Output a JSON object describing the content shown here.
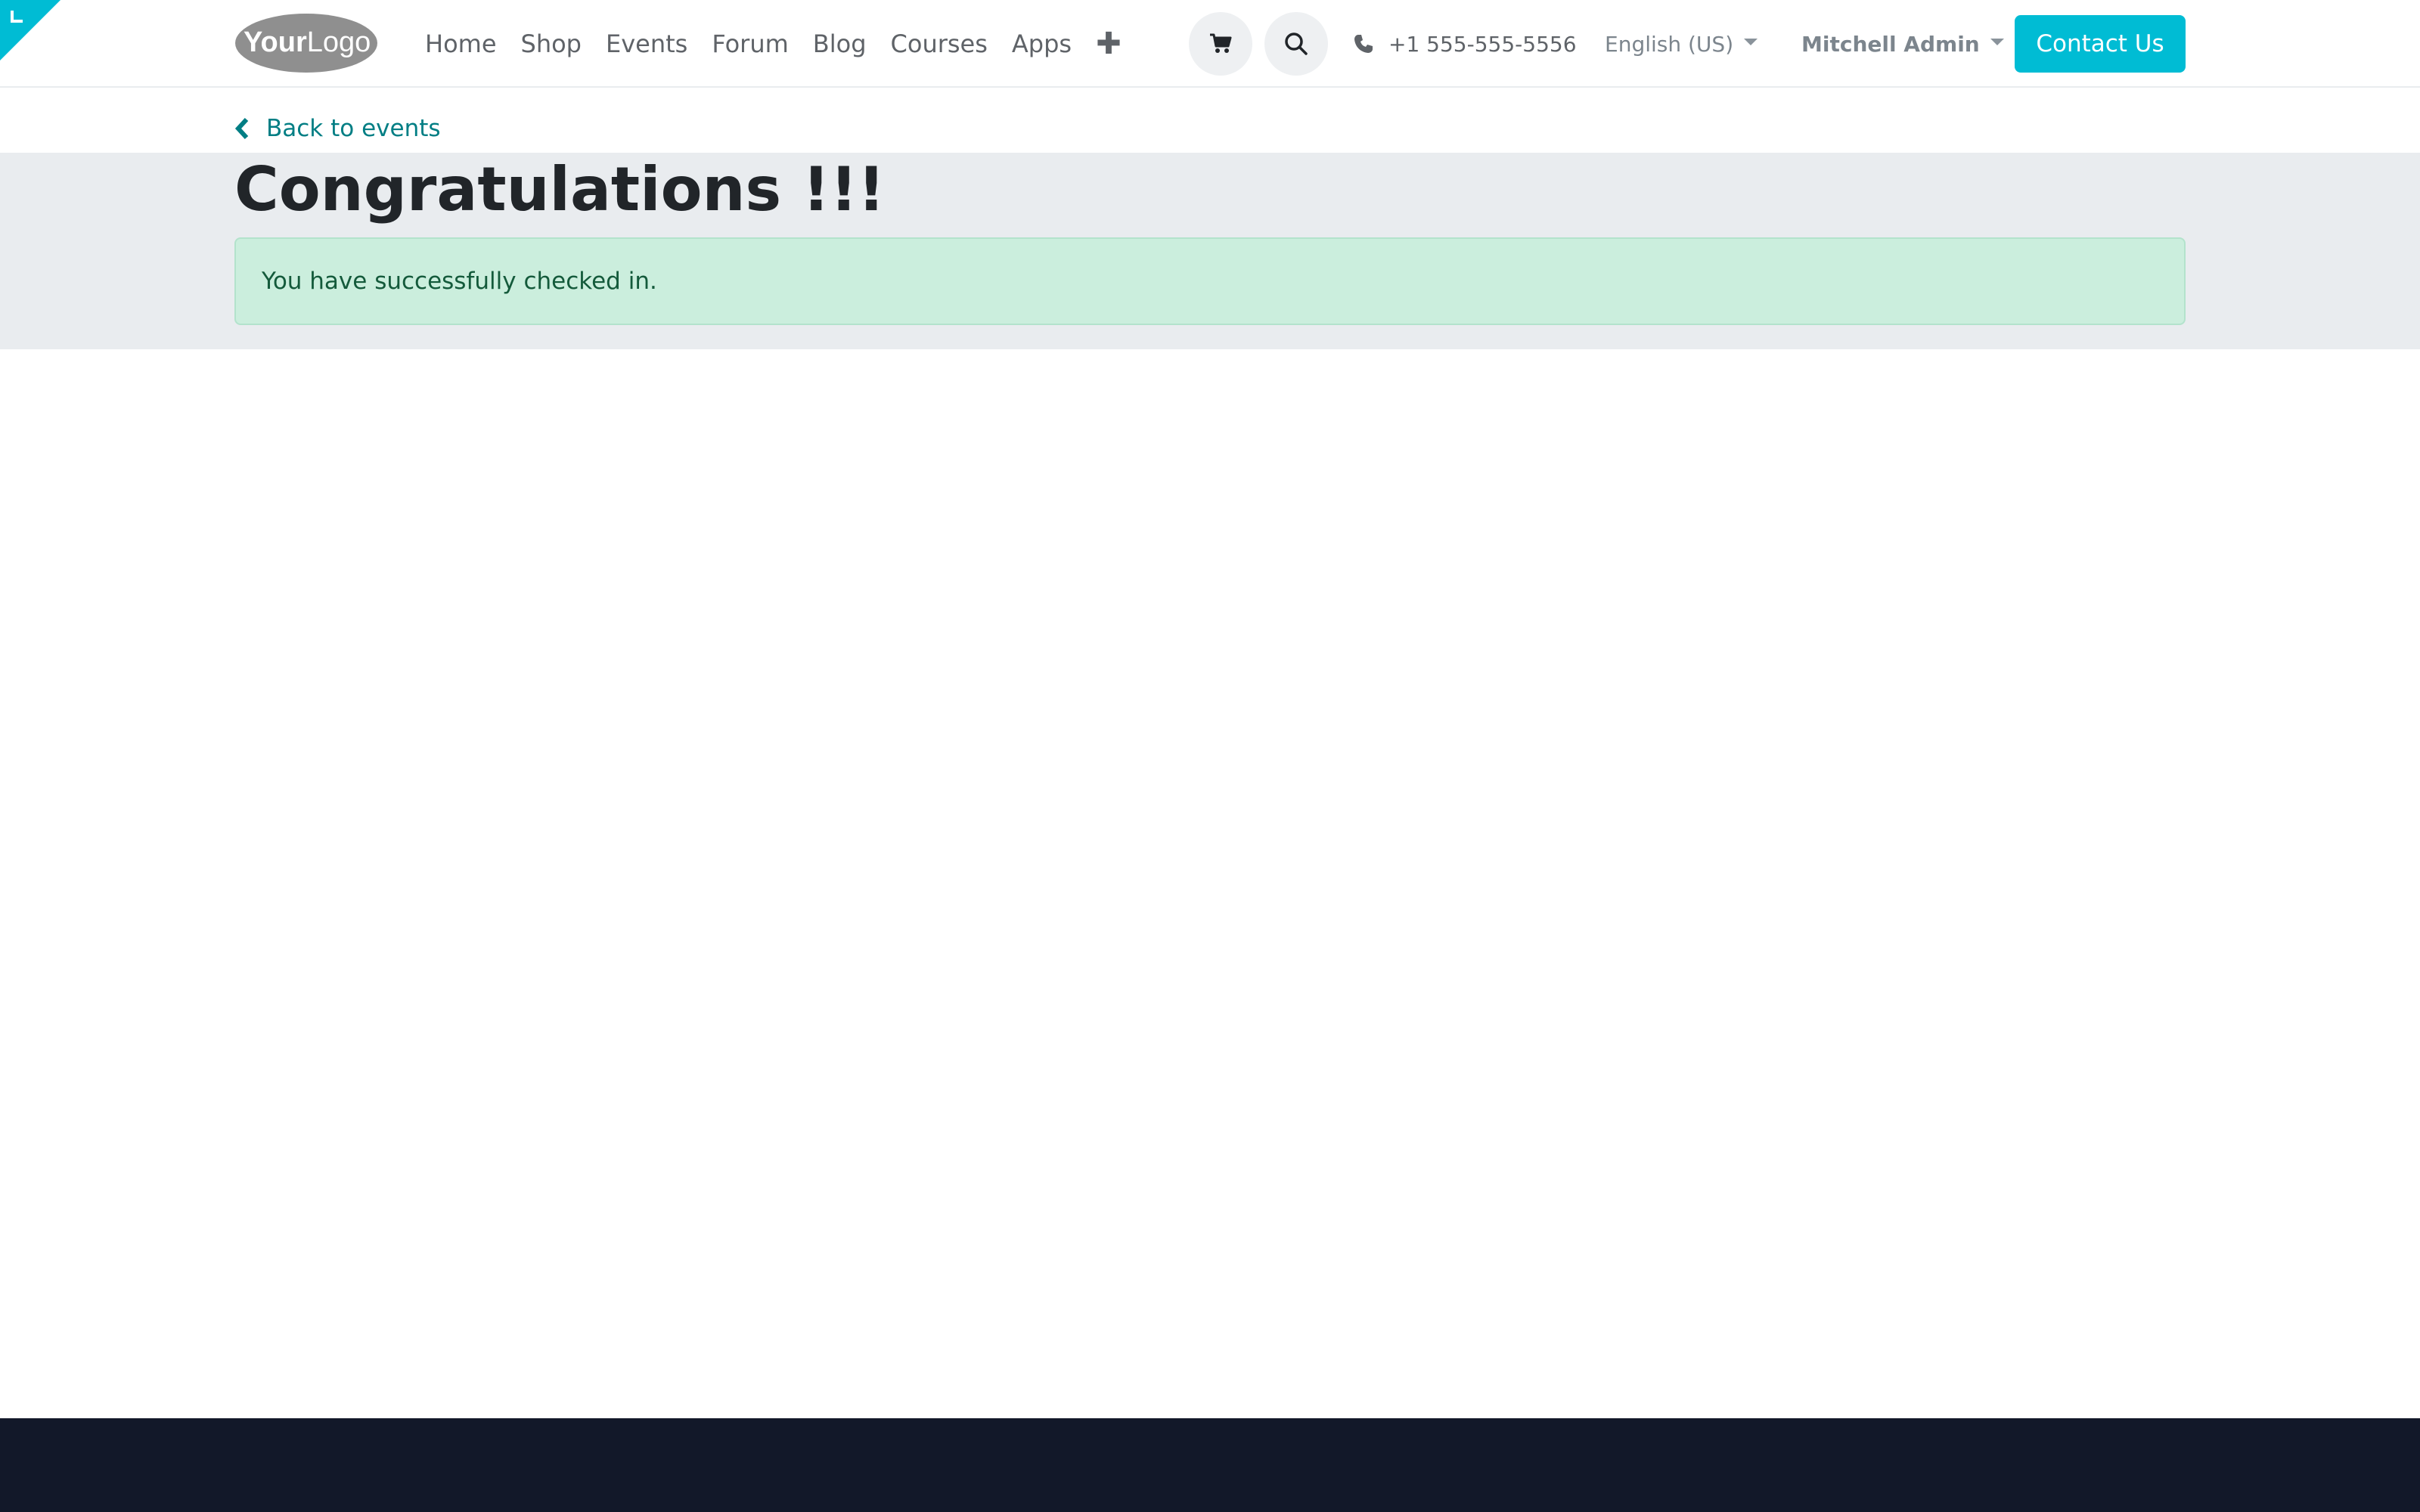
{
  "colors": {
    "accent": "#00bcd4",
    "link": "#017e84",
    "band_background": "#e9ecef",
    "success_background": "#cbeedd",
    "success_text": "#145a3b",
    "footer": "#121829"
  },
  "header": {
    "logo": {
      "text_bold": "Your",
      "text_light": "Logo"
    },
    "nav": [
      {
        "label": "Home"
      },
      {
        "label": "Shop"
      },
      {
        "label": "Events"
      },
      {
        "label": "Forum"
      },
      {
        "label": "Blog"
      },
      {
        "label": "Courses"
      },
      {
        "label": "Apps"
      }
    ],
    "nav_add_icon": "plus-icon",
    "cart_icon": "cart-icon",
    "search_icon": "search-icon",
    "phone_icon": "phone-icon",
    "phone": "+1 555-555-5556",
    "language": "English (US)",
    "user": "Mitchell Admin",
    "contact_button": "Contact Us"
  },
  "breadcrumb": {
    "back_icon": "chevron-left-icon",
    "back_label": "Back to events"
  },
  "main": {
    "title": "Congratulations !!!",
    "alert_message": "You have successfully checked in."
  }
}
